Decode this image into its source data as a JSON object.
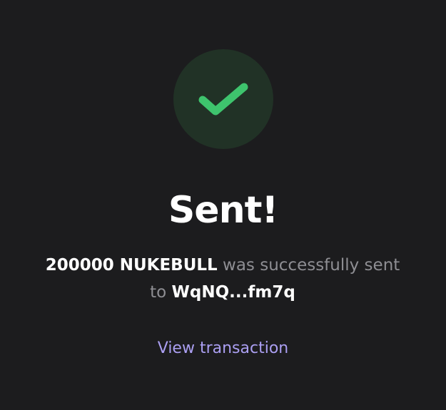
{
  "success": {
    "icon": "checkmark-icon",
    "icon_color": "#3ec46d",
    "circle_color": "#213226"
  },
  "title": "Sent!",
  "message": {
    "amount": "200000 NUKEBULL",
    "text_before_recipient": " was successfully sent to ",
    "recipient": "WqNQ...fm7q"
  },
  "view_transaction_label": "View transaction",
  "colors": {
    "background": "#1c1c1e",
    "link": "#ab9ff2",
    "muted_text": "#8e8e93"
  }
}
